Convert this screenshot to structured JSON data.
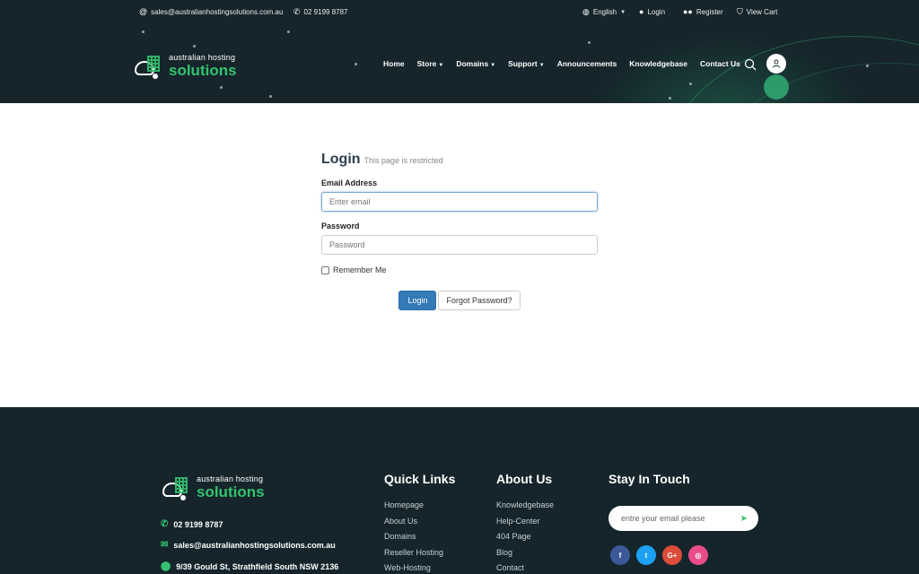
{
  "topbar": {
    "email": "sales@australianhostingsolutions.com.au",
    "phone": "02 9199 8787",
    "language": "English",
    "login": "Login",
    "register": "Register",
    "view_cart": "View Cart"
  },
  "brand": {
    "line1": "australian hosting",
    "line2": "solutions"
  },
  "nav": {
    "items": [
      {
        "label": "Home",
        "dropdown": false
      },
      {
        "label": "Store",
        "dropdown": true
      },
      {
        "label": "Domains",
        "dropdown": true
      },
      {
        "label": "Support",
        "dropdown": true
      },
      {
        "label": "Announcements",
        "dropdown": false
      },
      {
        "label": "Knowledgebase",
        "dropdown": false
      },
      {
        "label": "Contact Us",
        "dropdown": false
      }
    ]
  },
  "login": {
    "title": "Login",
    "subtitle": "This page is restricted",
    "email_label": "Email Address",
    "email_placeholder": "Enter email",
    "password_label": "Password",
    "password_placeholder": "Password",
    "remember_label": "Remember Me",
    "submit_label": "Login",
    "forgot_label": "Forgot Password?"
  },
  "footer": {
    "phone": "02 9199 8787",
    "email": "sales@australianhostingsolutions.com.au",
    "address": "9/39 Gould St, Strathfield South NSW 2136",
    "quick_links": {
      "title": "Quick Links",
      "items": [
        "Homepage",
        "About Us",
        "Domains",
        "Reseller Hosting",
        "Web-Hosting"
      ]
    },
    "about_us": {
      "title": "About Us",
      "items": [
        "Knowledgebase",
        "Help-Center",
        "404 Page",
        "Blog",
        "Contact"
      ]
    },
    "stay_in_touch": {
      "title": "Stay In Touch",
      "subscribe_placeholder": "entre your email please"
    },
    "socials": [
      {
        "icon": "facebook-icon",
        "glyph": "f",
        "color": "#3b5998"
      },
      {
        "icon": "twitter-icon",
        "glyph": "t",
        "color": "#1da1f2"
      },
      {
        "icon": "google-plus-icon",
        "glyph": "G+",
        "color": "#dd4b39"
      },
      {
        "icon": "dribbble-icon",
        "glyph": "◎",
        "color": "#ea4c89"
      }
    ]
  },
  "colors": {
    "header_bg": "#15252b",
    "accent_green": "#35c26f",
    "primary_button": "#337ab7"
  }
}
